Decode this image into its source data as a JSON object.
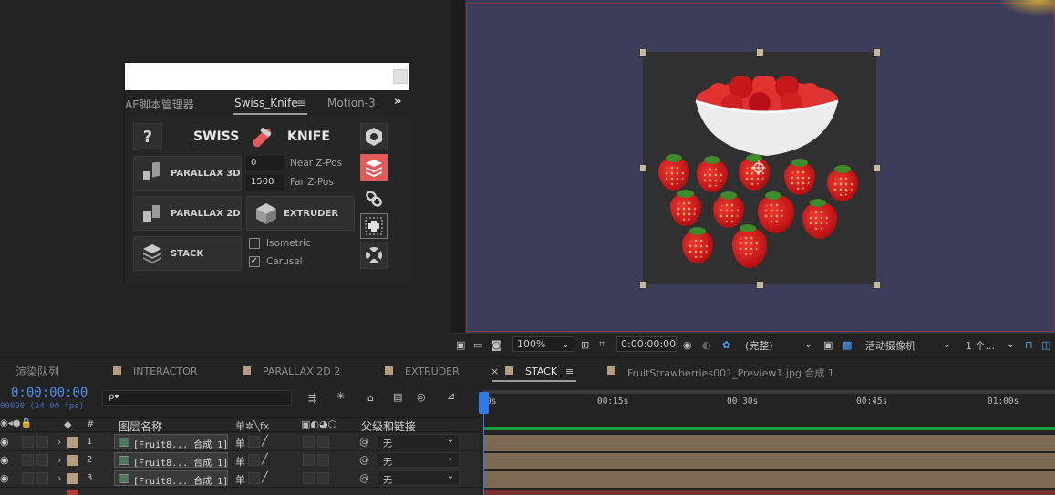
{
  "panel": {
    "tabs": [
      "AE脚本管理器",
      "Swiss_Knife",
      "Motion-3"
    ],
    "active_tab": "Swiss_Knife",
    "overflow": "»",
    "help": "?",
    "logo_left": "SWISS",
    "logo_right": "KNIFE",
    "buttons": {
      "parallax3d": "PARALLAX 3D",
      "parallax2d": "PARALLAX 2D",
      "stack": "STACK",
      "extruder": "EXTRUDER"
    },
    "near_z_value": "0",
    "near_z_label": "Near Z-Pos",
    "far_z_value": "1500",
    "far_z_label": "Far Z-Pos",
    "isometric": "Isometric",
    "carusel": "Carusel",
    "isometric_checked": false,
    "carusel_checked": true,
    "accent": "#e35a5a"
  },
  "viewer": {
    "zoom": "100%",
    "timecode": "0:00:00:00",
    "quality": "(完整)",
    "camera": "活动摄像机",
    "views": "1 个...",
    "bg": "#3a3c5a"
  },
  "tabs": {
    "render_queue": "渲染队列",
    "items": [
      "INTERACTOR",
      "PARALLAX 2D 2",
      "EXTRUDER",
      "STACK",
      "FruitStrawberries001_Preview1.jpg 合成 1"
    ],
    "active": "STACK",
    "close": "×",
    "menu": "≡"
  },
  "timeline": {
    "timecode": "0:00:00:00",
    "fps": "00000 (24.00 fps)",
    "search_placeholder": "ρ▾",
    "col_num": "#",
    "col_name": "图层名称",
    "col_parent": "父级和链接",
    "switch_icons": "单✲╲fx",
    "ticks": [
      "0s",
      "00:15s",
      "00:30s",
      "00:45s",
      "01:00s"
    ],
    "layers": [
      {
        "num": "1",
        "name": "[Fruit8... 合成 1]",
        "parent": "无"
      },
      {
        "num": "2",
        "name": "[Fruit8... 合成 1]",
        "parent": "无"
      },
      {
        "num": "3",
        "name": "[Fruit8... 合成 1]",
        "parent": "无"
      }
    ],
    "layer_color": "#b39f7f",
    "bar_color": "#7c6b52",
    "playhead_color": "#2f7bea"
  }
}
